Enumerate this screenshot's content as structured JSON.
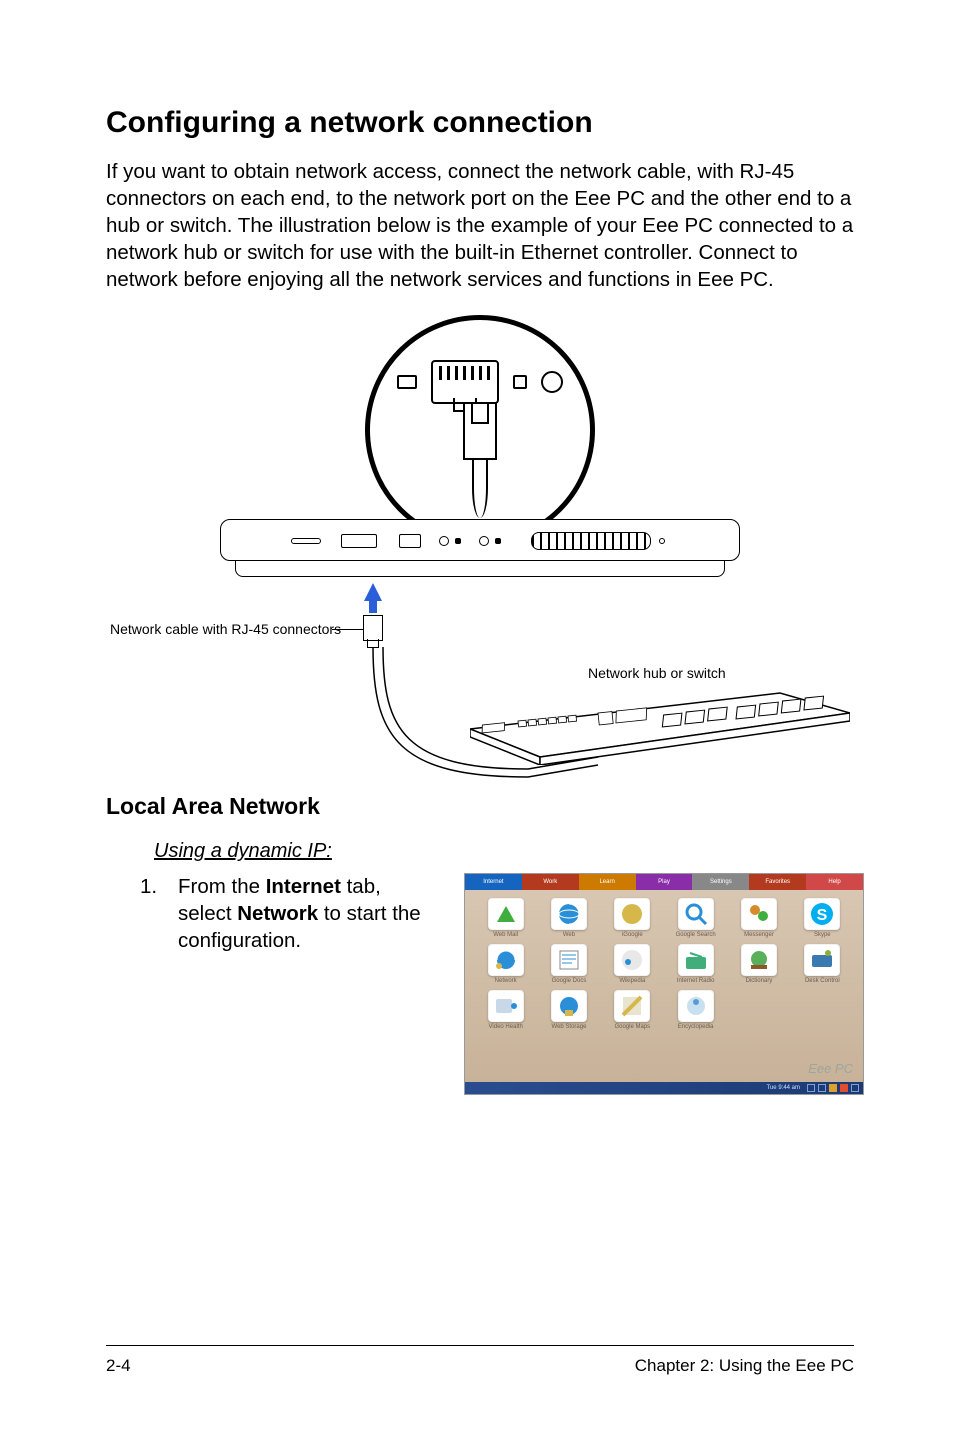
{
  "title": "Configuring a network connection",
  "intro": "If you want to obtain network access, connect the network cable, with RJ-45 connectors on each end, to the network port on the Eee PC and the other end to a hub or switch. The illustration below is the example of your Eee PC connected to a network hub or switch for use with the built-in Ethernet controller. Connect to network before enjoying all the network services and functions in Eee PC.",
  "diagram": {
    "cable_label": "Network cable with RJ-45 connectors",
    "hub_label": "Network hub or switch"
  },
  "section": "Local Area Network",
  "subsection": "Using a dynamic IP:",
  "step": {
    "num": "1.",
    "text_pre": "From the ",
    "bold1": "Internet",
    "text_mid": " tab, select ",
    "bold2": "Network",
    "text_post": " to start the configuration."
  },
  "screenshot": {
    "tabs": [
      "Internet",
      "Work",
      "Learn",
      "Play",
      "Settings",
      "Favorites",
      "Help"
    ],
    "launchers_row1": [
      "Web Mail",
      "Web",
      "iGoogle",
      "Google Search",
      "Messenger",
      "Skype"
    ],
    "launchers_row2": [
      "Network",
      "Google Docs",
      "Wikipedia",
      "Internet Radio",
      "Dictionary",
      "Desk Control"
    ],
    "launchers_row3": [
      "Video Health",
      "Web Storage",
      "Google Maps",
      "Encyclopedia"
    ],
    "brand": "Eee PC",
    "tray_text": "Tue 9:44 am"
  },
  "footer": {
    "left": "2-4",
    "right": "Chapter 2: Using the Eee PC"
  }
}
